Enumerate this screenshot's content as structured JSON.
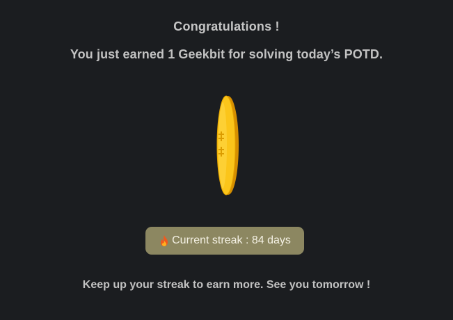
{
  "dialog": {
    "title": "Congratulations !",
    "message": "You just earned 1 Geekbit for solving today’s POTD.",
    "coin_icon": "geekbit-coin-icon",
    "streak": {
      "icon": "fire-icon",
      "label": "Current streak : 84 days"
    },
    "footer": "Keep up your streak to earn more. See you tomorrow !"
  },
  "colors": {
    "background": "#1b1d20",
    "text": "#c6c6c6",
    "coin": "#f5b800",
    "streak_badge": "#8c8761"
  }
}
